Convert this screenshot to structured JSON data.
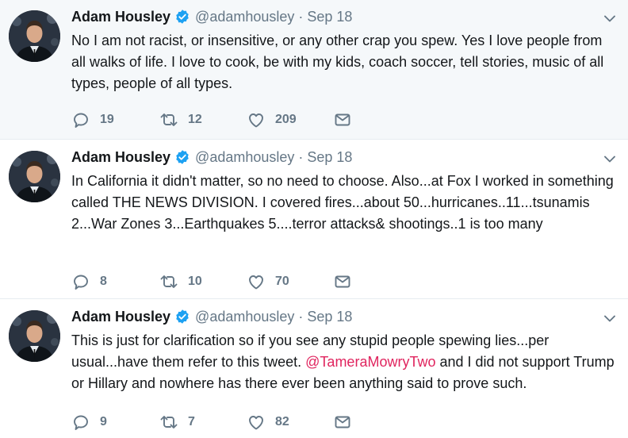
{
  "tweets": [
    {
      "name": "Adam Housley",
      "handle": "@adamhousley",
      "separator": "·",
      "date": "Sep 18",
      "text": "No I am not racist, or insensitive, or any other crap you spew. Yes I love people from all walks of life. I love to cook, be with my kids, coach soccer, tell stories, music of all types, people of all types.",
      "replies": "19",
      "retweets": "12",
      "likes": "209"
    },
    {
      "name": "Adam Housley",
      "handle": "@adamhousley",
      "separator": "·",
      "date": "Sep 18",
      "text": "In California it didn't matter, so no need to choose. Also...at Fox I worked in something called THE NEWS DIVISION. I covered fires...about 50...hurricanes..11...tsunamis 2...War Zones 3...Earthquakes 5....terror attacks& shootings..1 is too many",
      "replies": "8",
      "retweets": "10",
      "likes": "70"
    },
    {
      "name": "Adam Housley",
      "handle": "@adamhousley",
      "separator": "·",
      "date": "Sep 18",
      "text_before": "This is just for clarification so if you see any stupid people spewing lies...per usual...have them refer to this tweet. ",
      "mention": "@TameraMowryTwo",
      "text_after": " and I did not support Trump or Hillary and nowhere has there ever been anything said to prove such.",
      "replies": "9",
      "retweets": "7",
      "likes": "82"
    }
  ],
  "colors": {
    "verified": "#1da1f2",
    "icon_gray": "#657786",
    "mention": "#e0245e",
    "highlight_bg": "#f5f8fa"
  },
  "icons": {
    "reply": "reply-icon",
    "retweet": "retweet-icon",
    "like": "heart-icon",
    "dm": "envelope-icon",
    "verified": "verified-badge-icon",
    "menu": "chevron-down-icon"
  }
}
